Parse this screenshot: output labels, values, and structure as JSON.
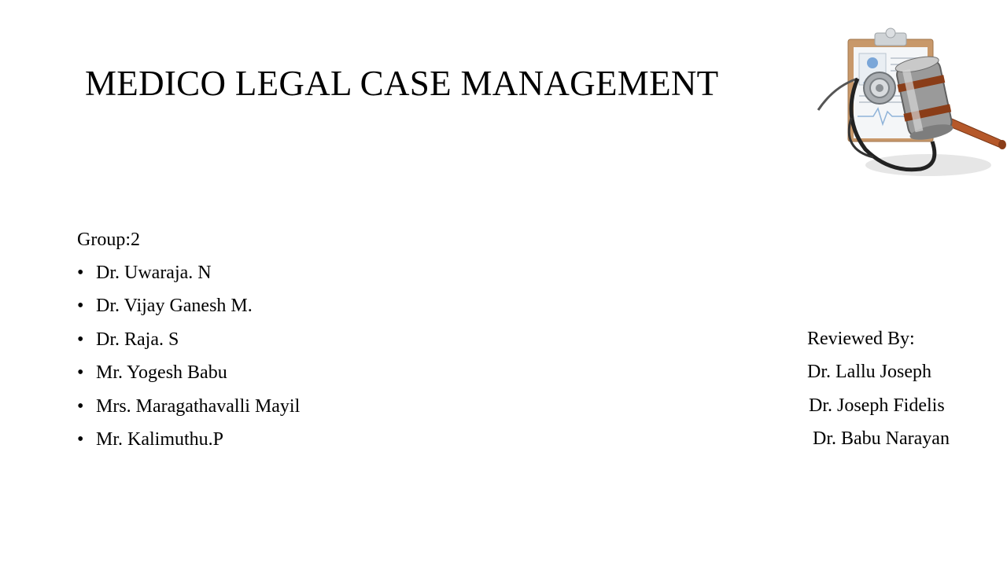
{
  "slide": {
    "title": "MEDICO LEGAL CASE MANAGEMENT",
    "group_label": "Group:2",
    "members": [
      "Dr. Uwaraja. N",
      "Dr. Vijay Ganesh M.",
      "Dr. Raja. S",
      "Mr. Yogesh Babu",
      "Mrs. Maragathavalli Mayil",
      "Mr. Kalimuthu.P"
    ],
    "bullet": "•",
    "reviewed_by_label": "Reviewed By:",
    "reviewers": [
      "Dr. Lallu Joseph",
      "Dr. Joseph Fidelis",
      "Dr. Babu Narayan"
    ],
    "illustration_icon": "clipboard-stethoscope-gavel-icon",
    "colors": {
      "text": "#000000",
      "background": "#ffffff",
      "gavel": "#b5582a",
      "metal": "#9a9a9a"
    }
  }
}
